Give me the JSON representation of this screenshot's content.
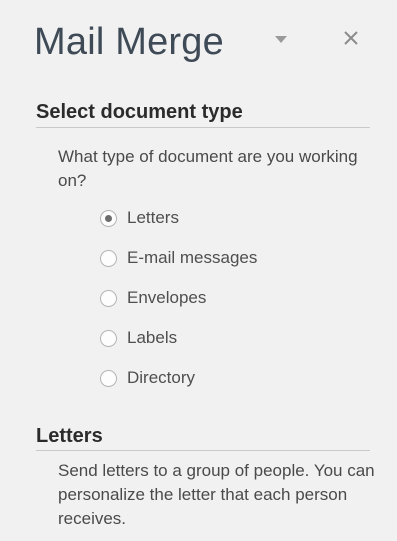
{
  "pane": {
    "title": "Mail Merge",
    "options_icon": "dropdown-arrow-icon",
    "close_icon": "close-icon"
  },
  "select_document_type": {
    "heading": "Select document type",
    "question": "What type of document are you working on?",
    "options": [
      {
        "label": "Letters",
        "selected": true
      },
      {
        "label": "E-mail messages",
        "selected": false
      },
      {
        "label": "Envelopes",
        "selected": false
      },
      {
        "label": "Labels",
        "selected": false
      },
      {
        "label": "Directory",
        "selected": false
      }
    ]
  },
  "selection_info": {
    "heading": "Letters",
    "description": "Send letters to a group of people. You can personalize the letter that each person receives."
  },
  "colors": {
    "pane_background": "#f1f1f1",
    "title_text": "#3f4a57",
    "heading_text": "#2b2b2b",
    "body_text": "#4a4a4a",
    "rule": "#c9c9c9"
  }
}
